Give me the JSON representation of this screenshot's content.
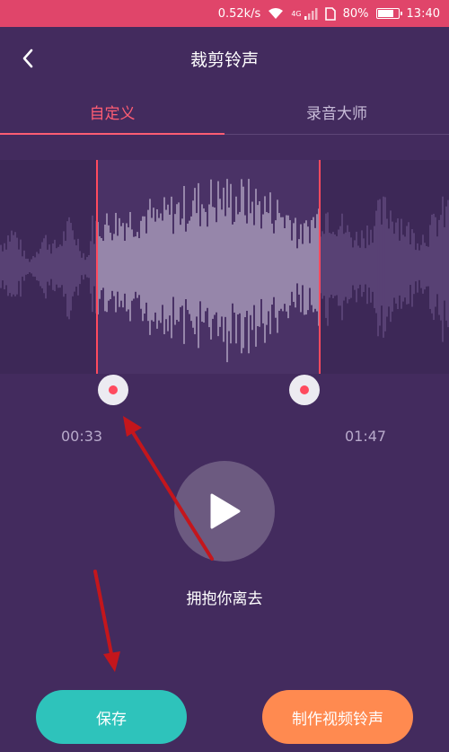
{
  "status_bar": {
    "speed": "0.52k/s",
    "network": "4G",
    "battery": "80%",
    "battery_level": 0.8,
    "time": "13:40"
  },
  "header": {
    "title": "裁剪铃声",
    "back_icon": "chevron-left-icon"
  },
  "tabs": [
    {
      "label": "自定义",
      "active": true
    },
    {
      "label": "录音大师",
      "active": false
    }
  ],
  "trim": {
    "start_time": "00:33",
    "end_time": "01:47"
  },
  "player": {
    "song_name": "拥抱你离去",
    "play_icon": "play-icon"
  },
  "buttons": {
    "save": "保存",
    "make_video_ringtone": "制作视频铃声"
  },
  "colors": {
    "background": "#432b5e",
    "status_bar": "#e0456a",
    "active_tab": "#ff5d73",
    "save_button": "#2ec3bb",
    "video_button": "#ff8a50",
    "annotation_arrow": "#c4161c"
  }
}
